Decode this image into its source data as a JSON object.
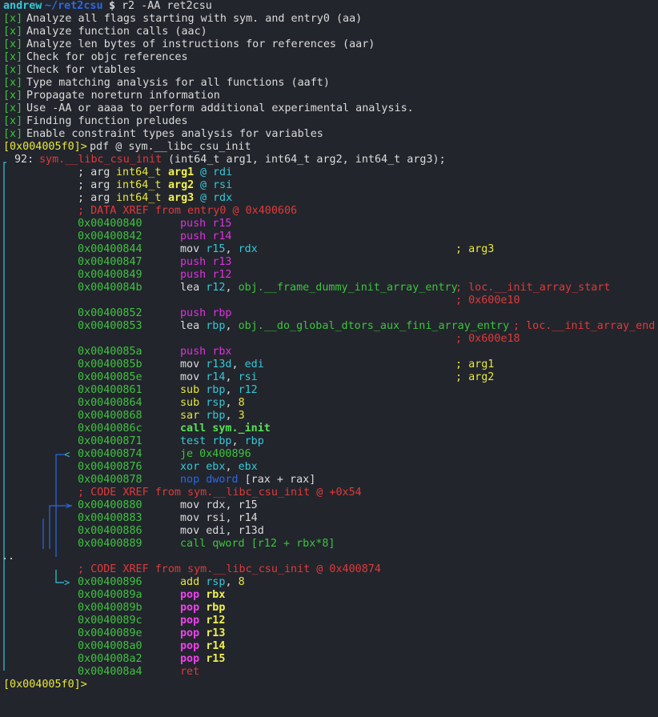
{
  "shell": {
    "user": "andrew",
    "cwd": "~/ret2csu",
    "prompt_symbol": "$",
    "command": "r2 -AA ret2csu"
  },
  "analysis": [
    "Analyze all flags starting with sym. and entry0 (aa)",
    "Analyze function calls (aac)",
    "Analyze len bytes of instructions for references (aar)",
    "Check for objc references",
    "Check for vtables",
    "Type matching analysis for all functions (aaft)",
    "Propagate noreturn information",
    "Use -AA or aaaa to perform additional experimental analysis.",
    "Finding function preludes",
    "Enable constraint types analysis for variables"
  ],
  "check_mark": "[x]",
  "r2_prompt": "[0x004005f0]>",
  "r2_command": "pdf @ sym.__libc_csu_init",
  "func": {
    "size": "92:",
    "name": "sym.__libc_csu_init",
    "signature": "(int64_t arg1, int64_t arg2, int64_t arg3);"
  },
  "args": [
    {
      "kw": "; arg",
      "type": "int64_t",
      "name": "arg1",
      "at": "@",
      "reg": "rdi"
    },
    {
      "kw": "; arg",
      "type": "int64_t",
      "name": "arg2",
      "at": "@",
      "reg": "rsi"
    },
    {
      "kw": "; arg",
      "type": "int64_t",
      "name": "arg3",
      "at": "@",
      "reg": "rdx"
    }
  ],
  "xrefs": {
    "data_entry": "; DATA XREF from entry0 @ 0x400606",
    "code_loop": "; CODE XREF from sym.__libc_csu_init @ +0x54",
    "code_je": "; CODE XREF from sym.__libc_csu_init @ 0x400874"
  },
  "separator": "..",
  "instructions": [
    {
      "addr": "0x00400840",
      "parts": [
        [
          "m",
          "push"
        ],
        [
          "w",
          " "
        ],
        [
          "m",
          "r15"
        ]
      ]
    },
    {
      "addr": "0x00400842",
      "parts": [
        [
          "m",
          "push"
        ],
        [
          "w",
          " "
        ],
        [
          "m",
          "r14"
        ]
      ]
    },
    {
      "addr": "0x00400844",
      "parts": [
        [
          "w",
          "mov "
        ],
        [
          "c",
          "r15"
        ],
        [
          "w",
          ", "
        ],
        [
          "c",
          "rdx"
        ]
      ],
      "comment": "; arg3"
    },
    {
      "addr": "0x00400847",
      "parts": [
        [
          "m",
          "push"
        ],
        [
          "w",
          " "
        ],
        [
          "m",
          "r13"
        ]
      ]
    },
    {
      "addr": "0x00400849",
      "parts": [
        [
          "m",
          "push"
        ],
        [
          "w",
          " "
        ],
        [
          "m",
          "r12"
        ]
      ]
    },
    {
      "addr": "0x0040084b",
      "parts": [
        [
          "w",
          "lea "
        ],
        [
          "c",
          "r12"
        ],
        [
          "w",
          ", "
        ],
        [
          "g",
          "obj.__frame_dummy_init_array_entry"
        ]
      ],
      "comment": "; loc.__init_array_start",
      "comment_color": "r",
      "comment2": "; 0x600e10"
    },
    {
      "addr": "0x00400852",
      "parts": [
        [
          "m",
          "push"
        ],
        [
          "w",
          " "
        ],
        [
          "m",
          "rbp"
        ]
      ]
    },
    {
      "addr": "0x00400853",
      "parts": [
        [
          "w",
          "lea "
        ],
        [
          "c",
          "rbp"
        ],
        [
          "w",
          ", "
        ],
        [
          "g",
          "obj.__do_global_dtors_aux_fini_array_entry"
        ]
      ],
      "comment": "; loc.__init_array_end",
      "comment_color": "r",
      "comment2": "; 0x600e18"
    },
    {
      "addr": "0x0040085a",
      "parts": [
        [
          "m",
          "push"
        ],
        [
          "w",
          " "
        ],
        [
          "m",
          "rbx"
        ]
      ]
    },
    {
      "addr": "0x0040085b",
      "parts": [
        [
          "w",
          "mov "
        ],
        [
          "c",
          "r13d"
        ],
        [
          "w",
          ", "
        ],
        [
          "c",
          "edi"
        ]
      ],
      "comment": "; arg1"
    },
    {
      "addr": "0x0040085e",
      "parts": [
        [
          "w",
          "mov "
        ],
        [
          "c",
          "r14"
        ],
        [
          "w",
          ", "
        ],
        [
          "c",
          "rsi"
        ]
      ],
      "comment": "; arg2"
    },
    {
      "addr": "0x00400861",
      "parts": [
        [
          "y",
          "sub "
        ],
        [
          "c",
          "rbp"
        ],
        [
          "w",
          ", "
        ],
        [
          "c",
          "r12"
        ]
      ]
    },
    {
      "addr": "0x00400864",
      "parts": [
        [
          "y",
          "sub "
        ],
        [
          "c",
          "rsp"
        ],
        [
          "w",
          ", "
        ],
        [
          "y",
          "8"
        ]
      ]
    },
    {
      "addr": "0x00400868",
      "parts": [
        [
          "y",
          "sar "
        ],
        [
          "c",
          "rbp"
        ],
        [
          "w",
          ", "
        ],
        [
          "y",
          "3"
        ]
      ]
    },
    {
      "addr": "0x0040086c",
      "parts": [
        [
          "bg",
          "call sym._init"
        ]
      ]
    },
    {
      "addr": "0x00400871",
      "parts": [
        [
          "c",
          "test "
        ],
        [
          "c",
          "rbp"
        ],
        [
          "w",
          ", "
        ],
        [
          "c",
          "rbp"
        ]
      ]
    },
    {
      "addr": "0x00400874",
      "parts": [
        [
          "g",
          "je 0x400896"
        ]
      ]
    },
    {
      "addr": "0x00400876",
      "parts": [
        [
          "c",
          "xor "
        ],
        [
          "c",
          "ebx"
        ],
        [
          "w",
          ", "
        ],
        [
          "c",
          "ebx"
        ]
      ]
    },
    {
      "addr": "0x00400878",
      "parts": [
        [
          "b",
          "nop "
        ],
        [
          "b",
          "dword "
        ],
        [
          "w",
          "[rax + rax]"
        ]
      ]
    },
    {
      "addr": "0x00400880",
      "parts": [
        [
          "w",
          "mov "
        ],
        [
          "w",
          "rdx"
        ],
        [
          "w",
          ", "
        ],
        [
          "w",
          "r15"
        ]
      ]
    },
    {
      "addr": "0x00400883",
      "parts": [
        [
          "w",
          "mov "
        ],
        [
          "w",
          "rsi"
        ],
        [
          "w",
          ", "
        ],
        [
          "w",
          "r14"
        ]
      ]
    },
    {
      "addr": "0x00400886",
      "parts": [
        [
          "w",
          "mov "
        ],
        [
          "w",
          "edi"
        ],
        [
          "w",
          ", "
        ],
        [
          "w",
          "r13d"
        ]
      ]
    },
    {
      "addr": "0x00400889",
      "parts": [
        [
          "g",
          "call qword "
        ],
        [
          "g",
          "[r12 + rbx*8]"
        ]
      ]
    },
    {
      "addr": "0x00400896",
      "parts": [
        [
          "y",
          "add "
        ],
        [
          "c",
          "rsp"
        ],
        [
          "w",
          ", "
        ],
        [
          "y",
          "8"
        ]
      ]
    },
    {
      "addr": "0x0040089a",
      "parts": [
        [
          "bm",
          "pop "
        ],
        [
          "by",
          "rbx"
        ]
      ]
    },
    {
      "addr": "0x0040089b",
      "parts": [
        [
          "bm",
          "pop "
        ],
        [
          "by",
          "rbp"
        ]
      ]
    },
    {
      "addr": "0x0040089c",
      "parts": [
        [
          "bm",
          "pop "
        ],
        [
          "by",
          "r12"
        ]
      ]
    },
    {
      "addr": "0x0040089e",
      "parts": [
        [
          "bm",
          "pop "
        ],
        [
          "by",
          "r13"
        ]
      ]
    },
    {
      "addr": "0x004008a0",
      "parts": [
        [
          "bm",
          "pop "
        ],
        [
          "by",
          "r14"
        ]
      ]
    },
    {
      "addr": "0x004008a2",
      "parts": [
        [
          "bm",
          "pop "
        ],
        [
          "by",
          "r15"
        ]
      ]
    },
    {
      "addr": "0x004008a4",
      "parts": [
        [
          "r",
          "ret"
        ]
      ]
    }
  ],
  "colors": {
    "background": "#22252c",
    "green": "#3ec43e",
    "yellow": "#e8e83a",
    "cyan": "#36c8d8",
    "blue": "#2a68e8",
    "magenta": "#e030e0",
    "red": "#e03a3a"
  }
}
